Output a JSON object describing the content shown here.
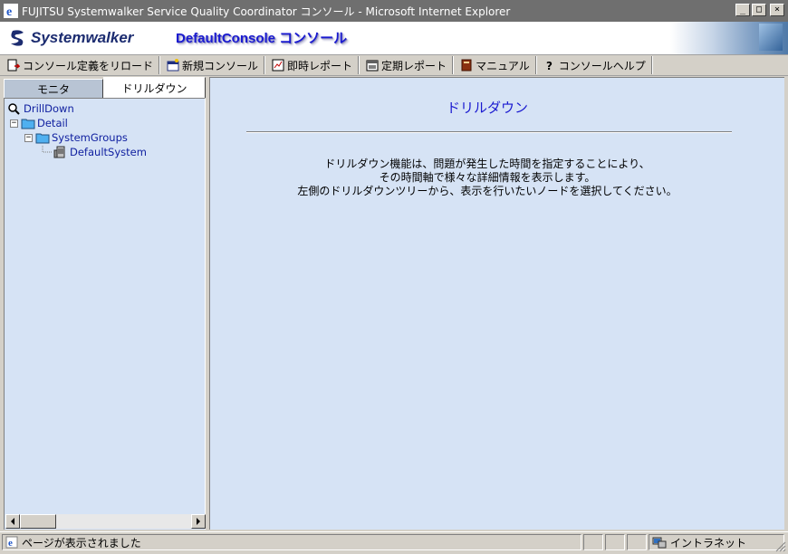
{
  "window": {
    "title": "FUJITSU Systemwalker Service Quality Coordinator コンソール - Microsoft Internet Explorer",
    "minimize_label": "_",
    "maximize_label": "□",
    "close_label": "×"
  },
  "header": {
    "logo_text": "Systemwalker",
    "console_title": "DefaultConsole コンソール"
  },
  "toolbar": {
    "items": [
      {
        "label": "コンソール定義をリロード",
        "icon": "reload-definition-icon"
      },
      {
        "label": "新規コンソール",
        "icon": "new-console-icon"
      },
      {
        "label": "即時レポート",
        "icon": "instant-report-icon"
      },
      {
        "label": "定期レポート",
        "icon": "scheduled-report-icon"
      },
      {
        "label": "マニュアル",
        "icon": "manual-book-icon"
      },
      {
        "label": "コンソールヘルプ",
        "icon": "help-icon"
      }
    ]
  },
  "left_panel": {
    "tabs": [
      {
        "label": "モニタ",
        "active": false
      },
      {
        "label": "ドリルダウン",
        "active": true
      }
    ],
    "tree": [
      {
        "label": "DrillDown",
        "icon": "magnifier-icon",
        "level": 0
      },
      {
        "label": "Detail",
        "icon": "folder-icon",
        "level": 0,
        "expander": "−"
      },
      {
        "label": "SystemGroups",
        "icon": "folder-icon",
        "level": 1,
        "expander": "−"
      },
      {
        "label": "DefaultSystem",
        "icon": "server-icon",
        "level": 2
      }
    ]
  },
  "content": {
    "title": "ドリルダウン",
    "description_lines": [
      "ドリルダウン機能は、問題が発生した時間を指定することにより、",
      "その時間軸で様々な詳細情報を表示します。",
      "左側のドリルダウンツリーから、表示を行いたいノードを選択してください。"
    ]
  },
  "statusbar": {
    "message": "ページが表示されました",
    "zone": "イントラネット"
  },
  "colors": {
    "panel_bg": "#d6e3f5",
    "title_blue": "#1a1ad0",
    "tree_text": "#1020a0",
    "chrome": "#d4d0c8"
  }
}
